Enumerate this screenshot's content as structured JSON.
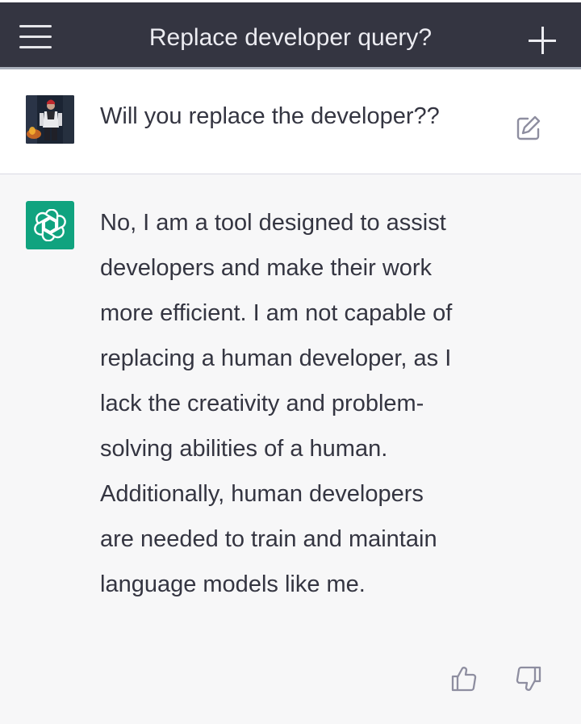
{
  "header": {
    "title": "Replace developer query?",
    "menu_icon": "hamburger-menu-icon",
    "new_chat_icon": "plus-icon",
    "background_color": "#343541"
  },
  "conversation": {
    "user_message": {
      "text": "Will you replace the developer??",
      "avatar": "user-avatar-image",
      "edit_icon": "edit-icon"
    },
    "assistant_message": {
      "text": "No, I am a tool designed to assist developers and make their work more efficient. I am not capable of replacing a human developer, as I lack the creativity and problem-solving abilities of a human. Additionally, human developers are needed to train and maintain language models like me.",
      "avatar": "openai-logo-icon",
      "avatar_color": "#10a37f",
      "feedback_icons": [
        "thumbs-up-icon",
        "thumbs-down-icon"
      ]
    }
  },
  "colors": {
    "text": "#343541",
    "assistant_background": "#f7f7f8",
    "user_background": "#ffffff"
  }
}
